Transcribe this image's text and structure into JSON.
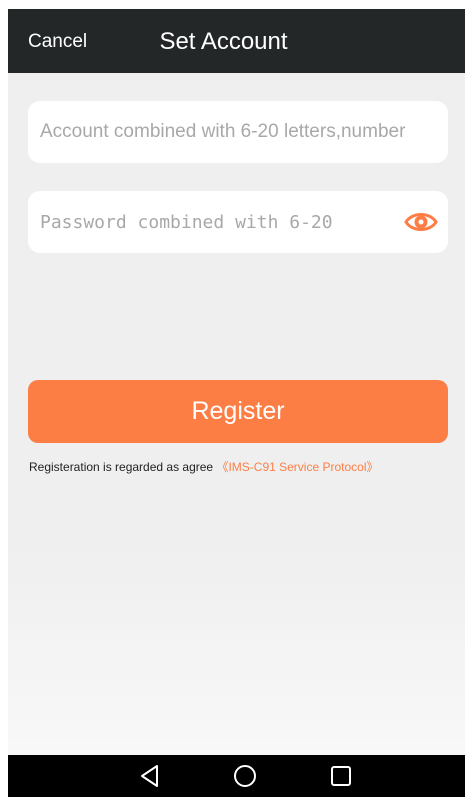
{
  "header": {
    "cancel_label": "Cancel",
    "title": "Set Account",
    "background_color": "#232727"
  },
  "form": {
    "account": {
      "value": "",
      "placeholder": "Account combined with 6-20 letters,number"
    },
    "password": {
      "value": "",
      "placeholder": "Password combined with 6-20",
      "toggle_icon": "eye-icon",
      "toggle_color": "#fd7e45"
    },
    "register_label": "Register",
    "register_color": "#fd7e45"
  },
  "agreement": {
    "prefix": "Registeration is regarded as agree",
    "protocol_link": "《IMS-C91 Service Protocol》",
    "link_color": "#fd7e45"
  },
  "system_nav": {
    "buttons": [
      "back-triangle-icon",
      "home-circle-icon",
      "recent-square-icon"
    ]
  }
}
